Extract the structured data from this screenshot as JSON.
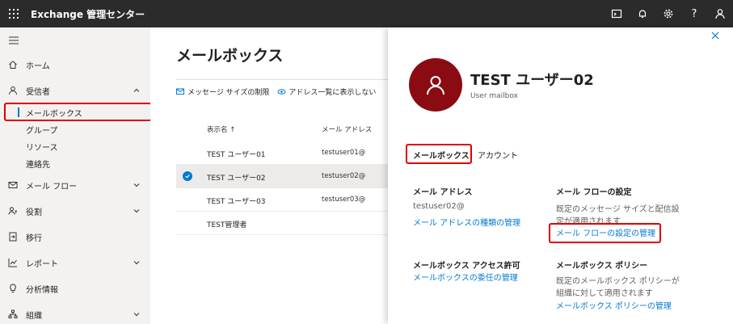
{
  "topbar": {
    "title": "Exchange 管理センター",
    "icons": [
      "waffle-icon",
      "terminal-icon",
      "bell-icon",
      "gear-icon",
      "help-icon",
      "person-icon"
    ],
    "help_glyph": "?"
  },
  "leftnav": {
    "items": [
      {
        "label": "ホーム",
        "icon": "home-icon"
      },
      {
        "label": "受信者",
        "icon": "person-icon",
        "expanded": true,
        "children": [
          "メールボックス",
          "グループ",
          "リソース",
          "連絡先"
        ]
      },
      {
        "label": "メール フロー",
        "icon": "mail-icon"
      },
      {
        "label": "役割",
        "icon": "roles-icon"
      },
      {
        "label": "移行",
        "icon": "migration-icon"
      },
      {
        "label": "レポート",
        "icon": "chart-icon"
      },
      {
        "label": "分析情報",
        "icon": "lightbulb-icon"
      },
      {
        "label": "組織",
        "icon": "org-icon"
      }
    ]
  },
  "main": {
    "title": "メールボックス",
    "commands": [
      "メッセージ サイズの制限",
      "アドレス一覧に表示しない"
    ],
    "columns": [
      "表示名 ↑",
      "メール アドレス"
    ],
    "rows": [
      {
        "name": "TEST ユーザー01",
        "email": "testuser01@"
      },
      {
        "name": "TEST ユーザー02",
        "email": "testuser02@",
        "selected": true
      },
      {
        "name": "TEST ユーザー03",
        "email": "testuser03@"
      },
      {
        "name": "TEST管理者",
        "email": ""
      }
    ]
  },
  "panel": {
    "display_name": "TEST ユーザー02",
    "type": "User mailbox",
    "tabs": [
      "メールボックス",
      "アカウント"
    ],
    "sections": {
      "email": {
        "title": "メール アドレス",
        "value": "testuser02@",
        "link": "メール アドレスの種類の管理"
      },
      "mailflow": {
        "title": "メール フローの設定",
        "text1": "既定のメッセージ サイズと配信設",
        "text2": "定が適用されます",
        "link": "メール フローの設定の管理"
      },
      "access": {
        "title": "メールボックス アクセス許可",
        "link": "メールボックスの委任の管理"
      },
      "policy": {
        "title": "メールボックス ポリシー",
        "text1": "既定のメールボックス ポリシーが",
        "text2": "組織に対して適用されます",
        "link": "メールボックス ポリシーの管理"
      }
    }
  },
  "colors": {
    "topbar": "#2b2b2b",
    "nav_bg": "#f3f2f1",
    "accent": "#0078d4",
    "avatar": "#8a0b12",
    "highlight_box": "#e00000"
  }
}
